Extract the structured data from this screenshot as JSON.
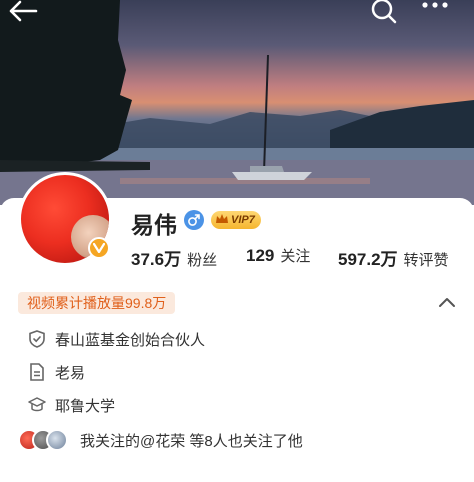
{
  "profile": {
    "name": "易伟",
    "vip_label": "VIP7"
  },
  "stats": [
    {
      "value": "37.6万",
      "label": "粉丝"
    },
    {
      "value": "129",
      "label": "关注"
    },
    {
      "value": "597.2万",
      "label": "转评赞"
    }
  ],
  "play_count": "视频累计播放量99.8万",
  "info": [
    {
      "icon": "shield-check-icon",
      "text": "春山蓝基金创始合伙人"
    },
    {
      "icon": "document-icon",
      "text": "老易"
    },
    {
      "icon": "graduation-cap-icon",
      "text": "耶鲁大学"
    }
  ],
  "mutual_follow": "我关注的@花荣 等8人也关注了他",
  "colors": {
    "accent_orange": "#e0601b",
    "play_bg": "#fbe9dd",
    "vip_gold": "#f5b52f",
    "gender_blue": "#4b93e6"
  }
}
